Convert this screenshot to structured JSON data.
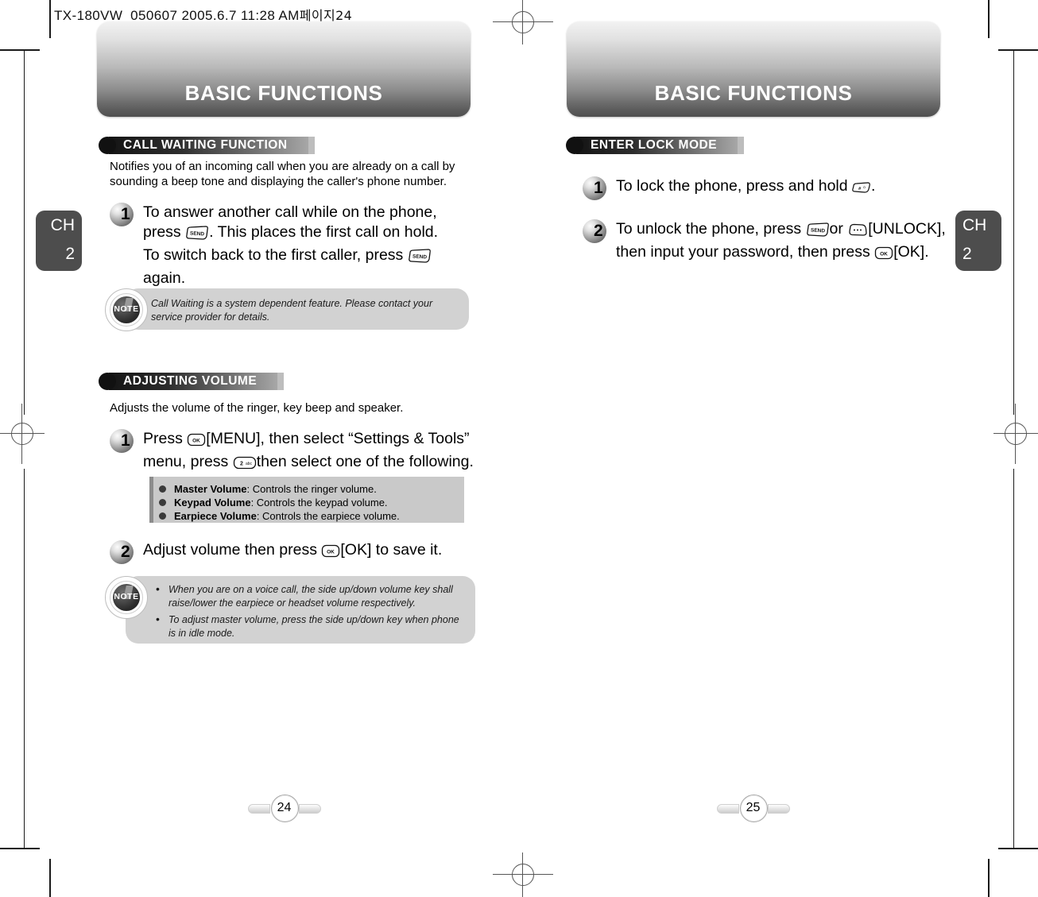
{
  "running_header": {
    "text": "TX-180VW_050607  2005.6.7 11:28 AM",
    "korean_suffix": "페이지",
    "page_ref": "24"
  },
  "left_page": {
    "banner_title": "BASIC FUNCTIONS",
    "chapter_tab": {
      "ch": "CH",
      "number": "2"
    },
    "page_number": "24",
    "sections": [
      {
        "heading": "CALL WAITING FUNCTION",
        "intro": "Notifies you of an incoming call when you are already on a call by sounding a beep tone and displaying the caller's phone number.",
        "steps": [
          {
            "number": "1",
            "line1_a": "To answer another call while on the phone,",
            "line2_a": "press",
            "key1": "SEND",
            "line2_b": ". This places the first call on hold.",
            "line3_a": "To switch back to the first caller, press",
            "key2": "SEND",
            "line4": "again."
          }
        ],
        "note": {
          "label": "NOTE",
          "lines": [
            "Call Waiting is a system dependent feature. Please contact your service provider for details."
          ]
        }
      },
      {
        "heading": "ADJUSTING VOLUME",
        "intro": "Adjusts the volume of the ringer, key beep and speaker.",
        "steps": [
          {
            "number": "1",
            "line1_a": "Press",
            "key1": "OK",
            "line1_b": "[MENU], then select “Settings & Tools”",
            "line2_a": "menu, press",
            "key2": "2 abc",
            "line2_b": "then select one of the following."
          },
          {
            "number": "2",
            "line1_a": "Adjust volume then press",
            "key1": "OK",
            "line1_b": "[OK] to save it."
          }
        ],
        "bullet_panel": [
          {
            "term": "Master Volume",
            "desc": " : Controls the ringer volume."
          },
          {
            "term": "Keypad Volume",
            "desc": " : Controls the keypad volume."
          },
          {
            "term": "Earpiece Volume",
            "desc": " : Controls the earpiece volume."
          }
        ],
        "note": {
          "label": "NOTE",
          "lines": [
            "When you are on a voice call, the side up/down volume key shall raise/lower the earpiece or headset volume respectively.",
            "To adjust master volume, press the side up/down key when phone is in idle mode."
          ]
        }
      }
    ]
  },
  "right_page": {
    "banner_title": "BASIC FUNCTIONS",
    "chapter_tab": {
      "ch": "CH",
      "number": "2"
    },
    "page_number": "25",
    "sections": [
      {
        "heading": "ENTER LOCK MODE",
        "steps": [
          {
            "number": "1",
            "line1_a": "To lock the phone, press and hold",
            "key1": "#",
            "line1_b": "."
          },
          {
            "number": "2",
            "line1_a": "To unlock the phone, press",
            "key1": "SEND",
            "line1_b": "or",
            "key2": "SOFT",
            "line1_c": "[UNLOCK],",
            "line2_a": "then input your password, then press",
            "key3": "OK",
            "line2_b": "[OK]."
          }
        ]
      }
    ]
  },
  "icons": {
    "send_key": "send-key-icon",
    "ok_key": "ok-key-icon",
    "num2_key": "num2-key-icon",
    "hash_key": "hash-key-icon",
    "soft_key": "soft-key-icon",
    "note_badge": "note-badge-icon"
  },
  "colors": {
    "banner_dark": "#4f4f4f",
    "banner_light": "#f2f2f2",
    "tab": "#4d4d4d",
    "note_bg": "#d2d2d2",
    "panel_bg": "#c9c9c9"
  }
}
